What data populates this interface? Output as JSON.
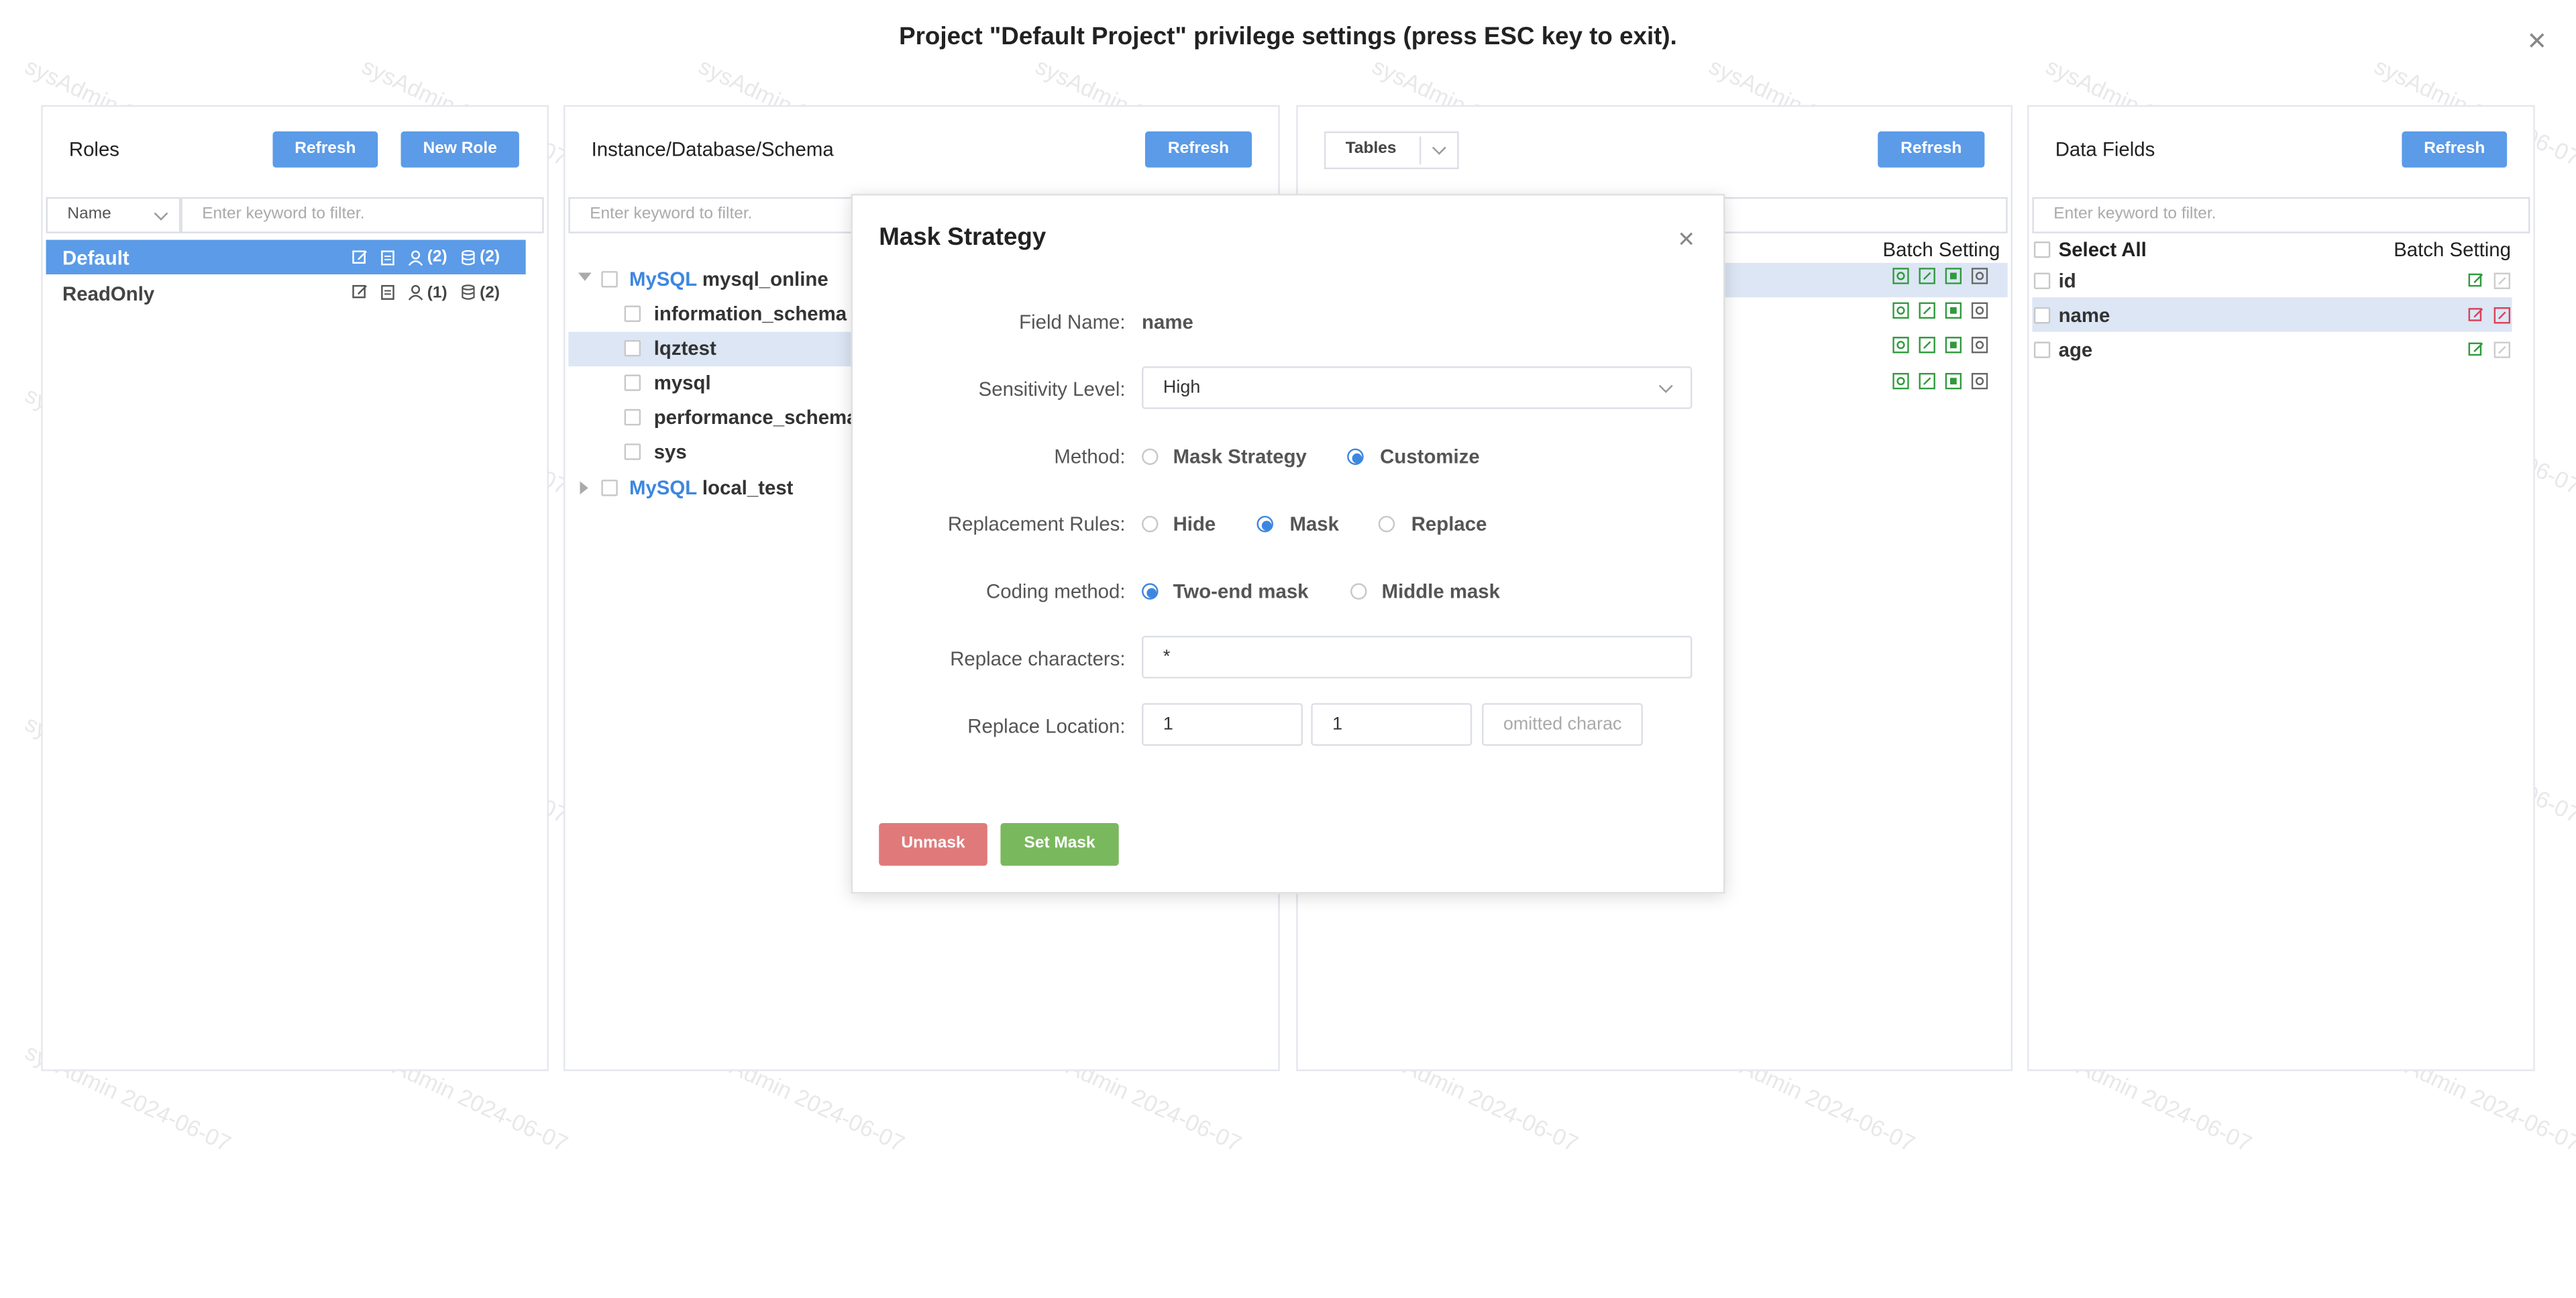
{
  "dialog_title": "Project \"Default Project\" privilege settings (press ESC key to exit).",
  "watermark": "sysAdmin 2024-06-07",
  "roles": {
    "title": "Roles",
    "refresh": "Refresh",
    "new_role": "New Role",
    "filter_select": "Name",
    "filter_placeholder": "Enter keyword to filter.",
    "items": [
      {
        "name": "Default",
        "users": "(2)",
        "dbs": "(2)"
      },
      {
        "name": "ReadOnly",
        "users": "(1)",
        "dbs": "(2)"
      }
    ]
  },
  "instances": {
    "title": "Instance/Database/Schema",
    "refresh": "Refresh",
    "filter_placeholder": "Enter keyword to filter.",
    "tree": [
      {
        "type": "MySQL",
        "name": "mysql_online",
        "children": [
          "information_schema",
          "lqztest",
          "mysql",
          "performance_schema",
          "sys"
        ]
      },
      {
        "type": "MySQL",
        "name": "local_test"
      }
    ]
  },
  "tables": {
    "type_select": "Tables",
    "refresh": "Refresh",
    "batch_setting": "Batch Setting"
  },
  "fields": {
    "title": "Data Fields",
    "refresh": "Refresh",
    "filter_placeholder": "Enter keyword to filter.",
    "select_all": "Select All",
    "batch_setting": "Batch Setting",
    "items": [
      "id",
      "name",
      "age"
    ]
  },
  "mask": {
    "title": "Mask Strategy",
    "field_name_label": "Field Name:",
    "field_name_value": "name",
    "sensitivity_label": "Sensitivity Level:",
    "sensitivity_value": "High",
    "method_label": "Method:",
    "method_options": [
      "Mask Strategy",
      "Customize"
    ],
    "replacement_label": "Replacement Rules:",
    "replacement_options": [
      "Hide",
      "Mask",
      "Replace"
    ],
    "coding_label": "Coding method:",
    "coding_options": [
      "Two-end mask",
      "Middle mask"
    ],
    "replace_chars_label": "Replace characters:",
    "replace_chars_value": "*",
    "location_label": "Replace Location:",
    "location_start": "1",
    "location_end": "1",
    "location_placeholder": "omitted charac",
    "unmask": "Unmask",
    "set_mask": "Set Mask"
  },
  "colors": {
    "accent": "#5b9be8",
    "selected_row": "#dce6f4",
    "unmask": "#e07a7a",
    "set_mask": "#7ab85e",
    "icon_green": "#2f9a3c",
    "icon_red": "#d9425a"
  }
}
